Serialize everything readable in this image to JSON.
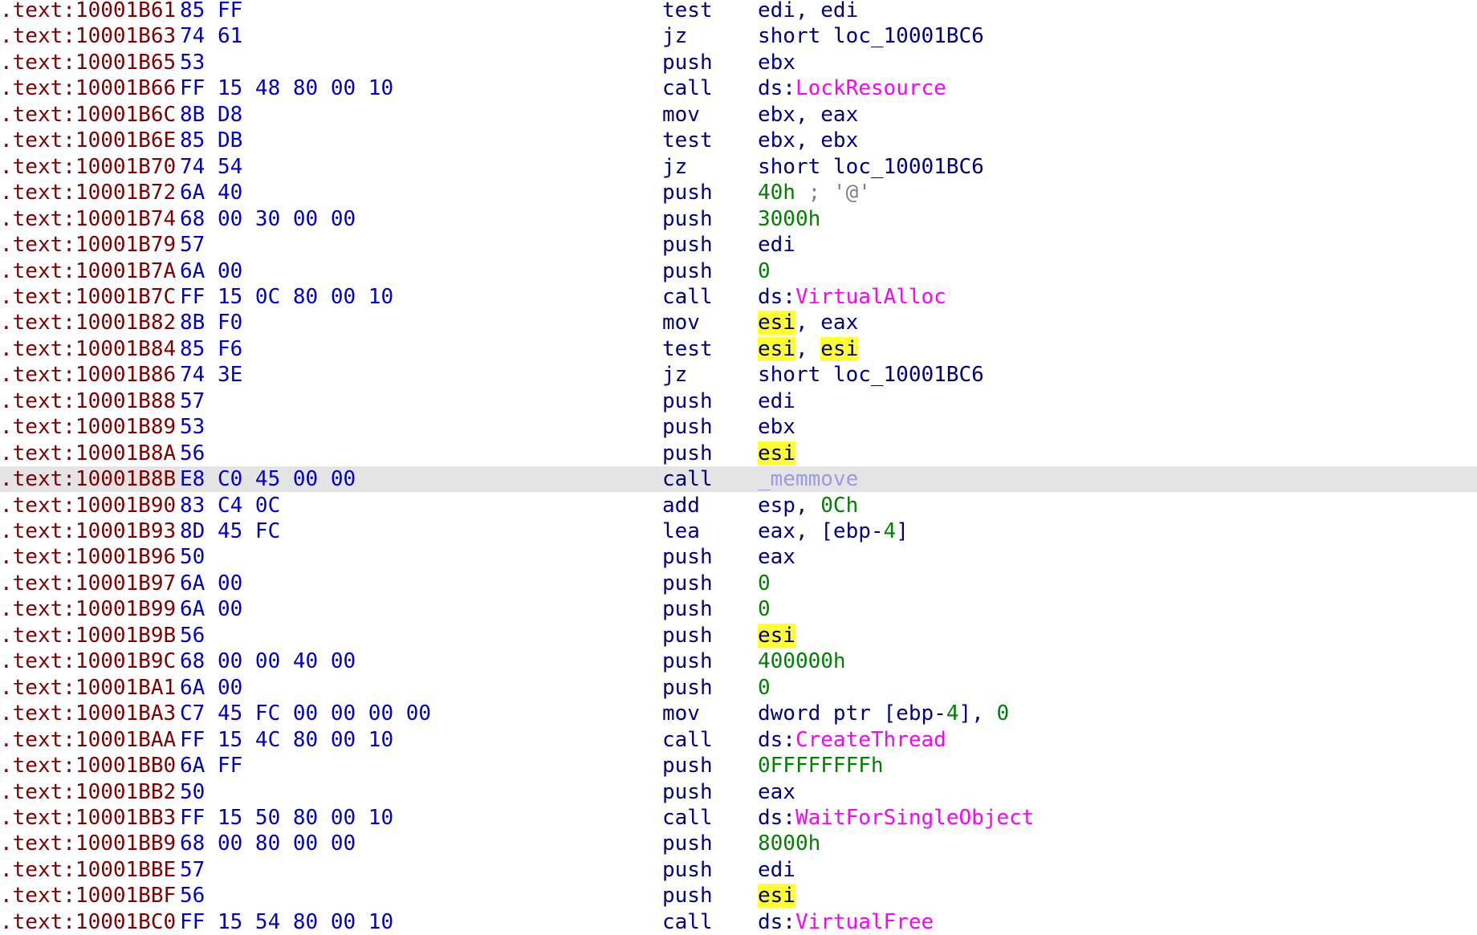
{
  "disassembly": {
    "highlight_color": "#ffff33",
    "current_line_color": "#e4e4e4",
    "rows": [
      {
        "addr": ".text:10001B61",
        "bytes": "85 FF",
        "mnem": "test",
        "ops": [
          {
            "t": "edi, edi"
          }
        ]
      },
      {
        "addr": ".text:10001B63",
        "bytes": "74 61",
        "mnem": "jz",
        "ops": [
          {
            "t": "short loc_10001BC6"
          }
        ]
      },
      {
        "addr": ".text:10001B65",
        "bytes": "53",
        "mnem": "push",
        "ops": [
          {
            "t": "ebx"
          }
        ]
      },
      {
        "addr": ".text:10001B66",
        "bytes": "FF 15 48 80 00 10",
        "mnem": "call",
        "ops": [
          {
            "t": "ds:"
          },
          {
            "t": "LockResource",
            "k": "api"
          }
        ]
      },
      {
        "addr": ".text:10001B6C",
        "bytes": "8B D8",
        "mnem": "mov",
        "ops": [
          {
            "t": "ebx, eax"
          }
        ]
      },
      {
        "addr": ".text:10001B6E",
        "bytes": "85 DB",
        "mnem": "test",
        "ops": [
          {
            "t": "ebx, ebx"
          }
        ]
      },
      {
        "addr": ".text:10001B70",
        "bytes": "74 54",
        "mnem": "jz",
        "ops": [
          {
            "t": "short loc_10001BC6"
          }
        ]
      },
      {
        "addr": ".text:10001B72",
        "bytes": "6A 40",
        "mnem": "push",
        "ops": [
          {
            "t": "40h",
            "k": "num"
          },
          {
            "t": " ; '@'",
            "k": "cmt"
          }
        ]
      },
      {
        "addr": ".text:10001B74",
        "bytes": "68 00 30 00 00",
        "mnem": "push",
        "ops": [
          {
            "t": "3000h",
            "k": "num"
          }
        ]
      },
      {
        "addr": ".text:10001B79",
        "bytes": "57",
        "mnem": "push",
        "ops": [
          {
            "t": "edi"
          }
        ]
      },
      {
        "addr": ".text:10001B7A",
        "bytes": "6A 00",
        "mnem": "push",
        "ops": [
          {
            "t": "0",
            "k": "num"
          }
        ]
      },
      {
        "addr": ".text:10001B7C",
        "bytes": "FF 15 0C 80 00 10",
        "mnem": "call",
        "ops": [
          {
            "t": "ds:"
          },
          {
            "t": "VirtualAlloc",
            "k": "api"
          }
        ]
      },
      {
        "addr": ".text:10001B82",
        "bytes": "8B F0",
        "mnem": "mov",
        "ops": [
          {
            "t": "esi",
            "k": "hl"
          },
          {
            "t": ", eax"
          }
        ]
      },
      {
        "addr": ".text:10001B84",
        "bytes": "85 F6",
        "mnem": "test",
        "ops": [
          {
            "t": "esi",
            "k": "hl"
          },
          {
            "t": ", "
          },
          {
            "t": "esi",
            "k": "hl"
          }
        ]
      },
      {
        "addr": ".text:10001B86",
        "bytes": "74 3E",
        "mnem": "jz",
        "ops": [
          {
            "t": "short loc_10001BC6"
          }
        ]
      },
      {
        "addr": ".text:10001B88",
        "bytes": "57",
        "mnem": "push",
        "ops": [
          {
            "t": "edi"
          }
        ]
      },
      {
        "addr": ".text:10001B89",
        "bytes": "53",
        "mnem": "push",
        "ops": [
          {
            "t": "ebx"
          }
        ]
      },
      {
        "addr": ".text:10001B8A",
        "bytes": "56",
        "mnem": "push",
        "ops": [
          {
            "t": "esi",
            "k": "hl"
          }
        ]
      },
      {
        "addr": ".text:10001B8B",
        "bytes": "E8 C0 45 00 00",
        "mnem": "call",
        "ops": [
          {
            "t": "_memmove",
            "k": "lib"
          }
        ],
        "current": true
      },
      {
        "addr": ".text:10001B90",
        "bytes": "83 C4 0C",
        "mnem": "add",
        "ops": [
          {
            "t": "esp, "
          },
          {
            "t": "0Ch",
            "k": "num"
          }
        ]
      },
      {
        "addr": ".text:10001B93",
        "bytes": "8D 45 FC",
        "mnem": "lea",
        "ops": [
          {
            "t": "eax, [ebp-"
          },
          {
            "t": "4",
            "k": "num"
          },
          {
            "t": "]"
          }
        ]
      },
      {
        "addr": ".text:10001B96",
        "bytes": "50",
        "mnem": "push",
        "ops": [
          {
            "t": "eax"
          }
        ]
      },
      {
        "addr": ".text:10001B97",
        "bytes": "6A 00",
        "mnem": "push",
        "ops": [
          {
            "t": "0",
            "k": "num"
          }
        ]
      },
      {
        "addr": ".text:10001B99",
        "bytes": "6A 00",
        "mnem": "push",
        "ops": [
          {
            "t": "0",
            "k": "num"
          }
        ]
      },
      {
        "addr": ".text:10001B9B",
        "bytes": "56",
        "mnem": "push",
        "ops": [
          {
            "t": "esi",
            "k": "hl"
          }
        ]
      },
      {
        "addr": ".text:10001B9C",
        "bytes": "68 00 00 40 00",
        "mnem": "push",
        "ops": [
          {
            "t": "400000h",
            "k": "num"
          }
        ]
      },
      {
        "addr": ".text:10001BA1",
        "bytes": "6A 00",
        "mnem": "push",
        "ops": [
          {
            "t": "0",
            "k": "num"
          }
        ]
      },
      {
        "addr": ".text:10001BA3",
        "bytes": "C7 45 FC 00 00 00 00",
        "mnem": "mov",
        "ops": [
          {
            "t": "dword ptr [ebp-"
          },
          {
            "t": "4",
            "k": "num"
          },
          {
            "t": "], "
          },
          {
            "t": "0",
            "k": "num"
          }
        ]
      },
      {
        "addr": ".text:10001BAA",
        "bytes": "FF 15 4C 80 00 10",
        "mnem": "call",
        "ops": [
          {
            "t": "ds:"
          },
          {
            "t": "CreateThread",
            "k": "api"
          }
        ]
      },
      {
        "addr": ".text:10001BB0",
        "bytes": "6A FF",
        "mnem": "push",
        "ops": [
          {
            "t": "0FFFFFFFFh",
            "k": "num"
          }
        ]
      },
      {
        "addr": ".text:10001BB2",
        "bytes": "50",
        "mnem": "push",
        "ops": [
          {
            "t": "eax"
          }
        ]
      },
      {
        "addr": ".text:10001BB3",
        "bytes": "FF 15 50 80 00 10",
        "mnem": "call",
        "ops": [
          {
            "t": "ds:"
          },
          {
            "t": "WaitForSingleObject",
            "k": "api"
          }
        ]
      },
      {
        "addr": ".text:10001BB9",
        "bytes": "68 00 80 00 00",
        "mnem": "push",
        "ops": [
          {
            "t": "8000h",
            "k": "num"
          }
        ]
      },
      {
        "addr": ".text:10001BBE",
        "bytes": "57",
        "mnem": "push",
        "ops": [
          {
            "t": "edi"
          }
        ]
      },
      {
        "addr": ".text:10001BBF",
        "bytes": "56",
        "mnem": "push",
        "ops": [
          {
            "t": "esi",
            "k": "hl"
          }
        ]
      },
      {
        "addr": ".text:10001BC0",
        "bytes": "FF 15 54 80 00 10",
        "mnem": "call",
        "ops": [
          {
            "t": "ds:"
          },
          {
            "t": "VirtualFree",
            "k": "api"
          }
        ]
      }
    ]
  }
}
